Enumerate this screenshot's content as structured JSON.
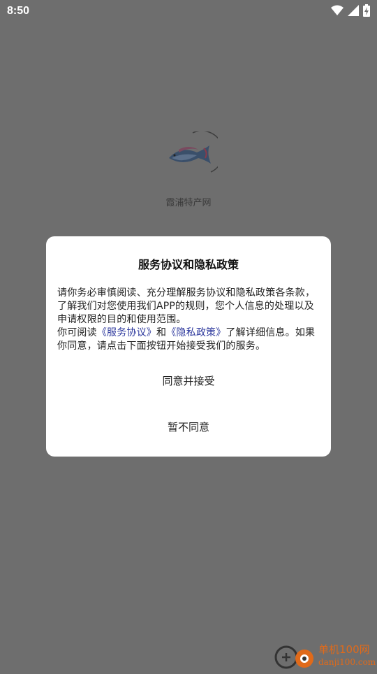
{
  "status_bar": {
    "time": "8:50",
    "icons": [
      "wifi-icon",
      "cellular-signal-icon",
      "battery-charging-icon"
    ]
  },
  "splash": {
    "app_name": "霞浦特产网",
    "logo_icon": "fish-logo-icon"
  },
  "dialog": {
    "title": "服务协议和隐私政策",
    "body_text_1": "请你务必审慎阅读、充分理解服务协议和隐私政策各条款，了解我们对您使用我们APP的规则，您个人信息的处理以及申请权限的目的和使用范围。",
    "body_text_2a": "你可阅读",
    "link_service": "《服务协议》",
    "body_and": "和",
    "link_privacy": "《隐私政策》",
    "body_text_2b": "了解详细信息。如果你同意，请点击下面按钮开始接受我们的服务。",
    "agree_label": "同意并接受",
    "disagree_label": "暂不同意"
  },
  "watermark": {
    "line1": "单机100网",
    "line2": "danji100.com"
  },
  "colors": {
    "overlay": "#6e6e6e",
    "link": "#2f3a9e",
    "watermark": "#e06a1a"
  }
}
